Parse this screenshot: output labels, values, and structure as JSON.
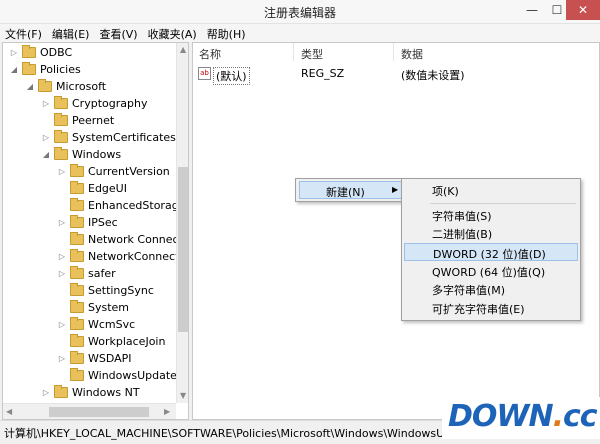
{
  "window": {
    "title": "注册表编辑器",
    "minimize": "—",
    "maximize": "☐",
    "close": "✕"
  },
  "menubar": [
    "文件(F)",
    "编辑(E)",
    "查看(V)",
    "收藏夹(A)",
    "帮助(H)"
  ],
  "tree": [
    {
      "label": "ODBC",
      "expander": "▷",
      "depth": 0
    },
    {
      "label": "Policies",
      "expander": "◢",
      "depth": 0
    },
    {
      "label": "Microsoft",
      "expander": "◢",
      "depth": 1
    },
    {
      "label": "Cryptography",
      "expander": "▷",
      "depth": 2
    },
    {
      "label": "Peernet",
      "expander": "",
      "depth": 2
    },
    {
      "label": "SystemCertificates",
      "expander": "▷",
      "depth": 2
    },
    {
      "label": "Windows",
      "expander": "◢",
      "depth": 2
    },
    {
      "label": "CurrentVersion",
      "expander": "▷",
      "depth": 3
    },
    {
      "label": "EdgeUI",
      "expander": "",
      "depth": 3
    },
    {
      "label": "EnhancedStorage",
      "expander": "",
      "depth": 3
    },
    {
      "label": "IPSec",
      "expander": "▷",
      "depth": 3
    },
    {
      "label": "Network Connect",
      "expander": "",
      "depth": 3
    },
    {
      "label": "NetworkConnecti",
      "expander": "▷",
      "depth": 3
    },
    {
      "label": "safer",
      "expander": "▷",
      "depth": 3
    },
    {
      "label": "SettingSync",
      "expander": "",
      "depth": 3
    },
    {
      "label": "System",
      "expander": "",
      "depth": 3
    },
    {
      "label": "WcmSvc",
      "expander": "▷",
      "depth": 3
    },
    {
      "label": "WorkplaceJoin",
      "expander": "",
      "depth": 3
    },
    {
      "label": "WSDAPI",
      "expander": "▷",
      "depth": 3
    },
    {
      "label": "WindowsUpdate",
      "expander": "",
      "depth": 3,
      "selected": true
    },
    {
      "label": "Windows NT",
      "expander": "▷",
      "depth": 2
    }
  ],
  "list": {
    "columns": [
      "名称",
      "类型",
      "数据"
    ],
    "rows": [
      {
        "icon": "ab",
        "name": "(默认)",
        "type": "REG_SZ",
        "data": "(数值未设置)"
      }
    ]
  },
  "context_menu": {
    "label": "新建(N)",
    "arrow": "▶"
  },
  "submenu": {
    "items": [
      "项(K)",
      "字符串值(S)",
      "二进制值(B)",
      "DWORD (32 位)值(D)",
      "QWORD (64 位)值(Q)",
      "多字符串值(M)",
      "可扩充字符串值(E)"
    ],
    "highlighted": "DWORD (32 位)值(D)"
  },
  "statusbar": {
    "path": "计算机\\HKEY_LOCAL_MACHINE\\SOFTWARE\\Policies\\Microsoft\\Windows\\WindowsUpdate"
  },
  "watermark": {
    "part1": "DOWN",
    "part2": ".",
    "part3": "cc"
  },
  "colors": {
    "close_button": "#c75050",
    "highlight": "#d5e6f7",
    "folder": "#e8c05c",
    "watermark_blue": "#1d64b8",
    "watermark_orange": "#e07b1a"
  }
}
